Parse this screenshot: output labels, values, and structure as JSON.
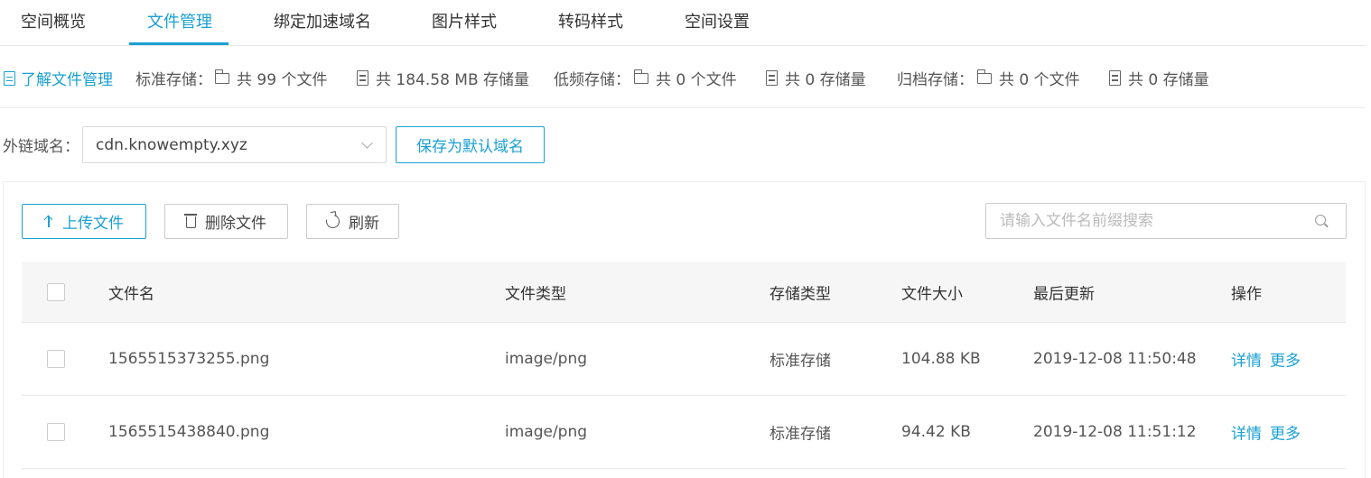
{
  "tabs": [
    {
      "label": "空间概览"
    },
    {
      "label": "文件管理"
    },
    {
      "label": "绑定加速域名"
    },
    {
      "label": "图片样式"
    },
    {
      "label": "转码样式"
    },
    {
      "label": "空间设置"
    }
  ],
  "active_tab": "文件管理",
  "stats": {
    "learn_label": "了解文件管理",
    "standard_label": "标准存储：",
    "standard_files": "共 99 个文件",
    "standard_size": "共 184.58 MB 存储量",
    "infrequent_label": "低频存储：",
    "infrequent_files": "共 0 个文件",
    "infrequent_size": "共 0 存储量",
    "archive_label": "归档存储：",
    "archive_files": "共 0 个文件",
    "archive_size": "共 0 存储量"
  },
  "domain": {
    "label": "外链域名：",
    "selected": "cdn.knowempty.xyz",
    "save_default_label": "保存为默认域名"
  },
  "toolbar": {
    "upload_label": "上传文件",
    "delete_label": "删除文件",
    "refresh_label": "刷新",
    "search_placeholder": "请输入文件名前缀搜索"
  },
  "table": {
    "columns": [
      "文件名",
      "文件类型",
      "存储类型",
      "文件大小",
      "最后更新",
      "操作"
    ],
    "rows": [
      {
        "name": "1565515373255.png",
        "type": "image/png",
        "storage": "标准存储",
        "size": "104.88 KB",
        "updated": "2019-12-08 11:50:48",
        "detail": "详情",
        "more": "更多"
      },
      {
        "name": "1565515438840.png",
        "type": "image/png",
        "storage": "标准存储",
        "size": "94.42 KB",
        "updated": "2019-12-08 11:51:12",
        "detail": "详情",
        "more": "更多"
      }
    ]
  },
  "colors": {
    "accent": "#1aa0d2"
  },
  "icons": [
    "document-icon",
    "folder-icon",
    "storage-icon",
    "chevron-down-icon",
    "upload-icon",
    "trash-icon",
    "refresh-icon",
    "search-icon"
  ]
}
